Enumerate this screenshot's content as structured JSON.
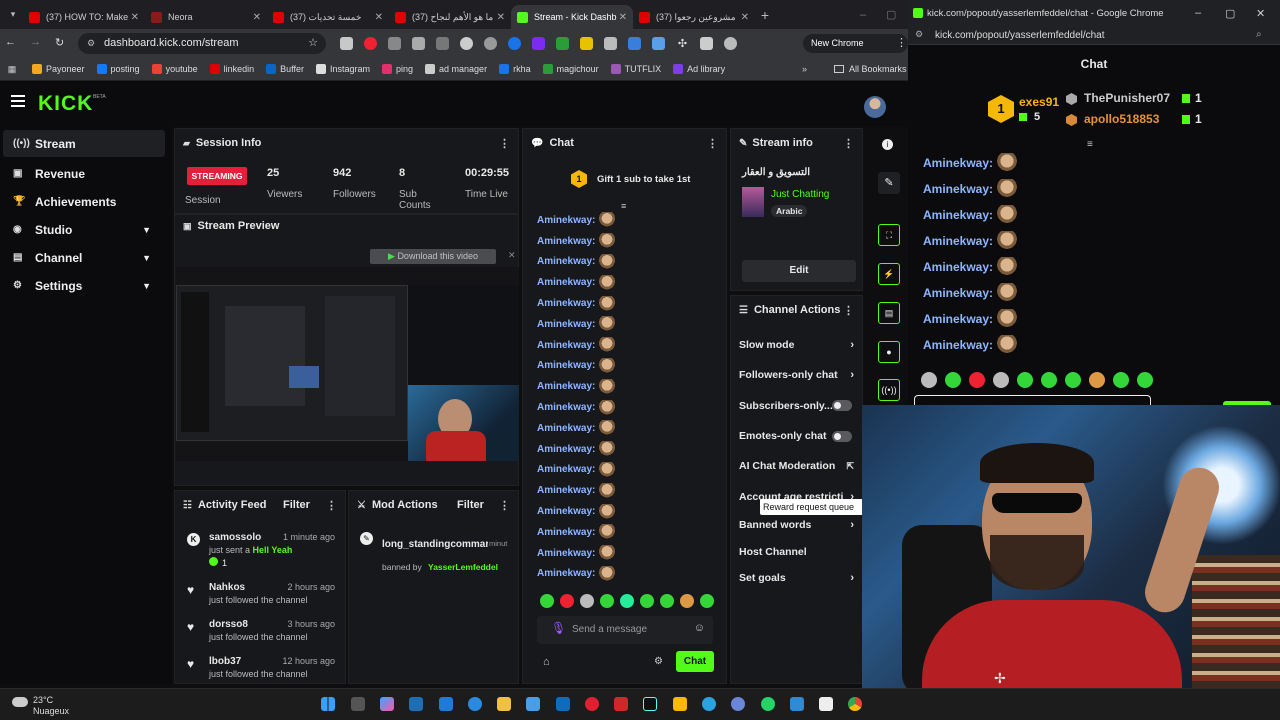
{
  "browser": {
    "tabs": [
      {
        "label": "(37) HOW TO: Make",
        "color": "#e00000"
      },
      {
        "label": "Neora",
        "color": "#8b1a1a"
      },
      {
        "label": "(37) خمسة تحديات",
        "color": "#e00000"
      },
      {
        "label": "(37) ما هو الأهم لنجاح",
        "color": "#e00000"
      },
      {
        "label": "Stream - Kick Dashb",
        "color": "#53fc18"
      },
      {
        "label": "(37) مشروعين رجعوا",
        "color": "#e00000"
      }
    ],
    "url": "dashboard.kick.com/stream",
    "chrome_available": "New Chrome available",
    "bookmarks": [
      "Payoneer",
      "posting",
      "youtube",
      "linkedin",
      "Buffer",
      "Instagram",
      "ping",
      "ad manager",
      "rkha",
      "magichour",
      "TUTFLIX",
      "Ad library"
    ],
    "all_bookmarks": "All Bookmarks"
  },
  "kick": {
    "logo": "KICK",
    "logo_tag": "BETA",
    "accent": "#53fc18",
    "nav": [
      {
        "label": "Stream",
        "icon": "broadcast-icon",
        "active": true,
        "chevron": false
      },
      {
        "label": "Revenue",
        "icon": "revenue-icon",
        "active": false,
        "chevron": false
      },
      {
        "label": "Achievements",
        "icon": "trophy-icon",
        "active": false,
        "chevron": false
      },
      {
        "label": "Studio",
        "icon": "studio-icon",
        "active": false,
        "chevron": true
      },
      {
        "label": "Channel",
        "icon": "channel-icon",
        "active": false,
        "chevron": true
      },
      {
        "label": "Settings",
        "icon": "gear-icon",
        "active": false,
        "chevron": true
      }
    ]
  },
  "session": {
    "title": "Session Info",
    "status": "STREAMING",
    "status_label": "Session",
    "stats": [
      {
        "value": "25",
        "label": "Viewers"
      },
      {
        "value": "942",
        "label": "Followers"
      },
      {
        "value": "8",
        "label": "Sub Counts"
      },
      {
        "value": "00:29:55",
        "label": "Time Live"
      }
    ]
  },
  "preview": {
    "title": "Stream Preview",
    "download": "Download this video"
  },
  "activity": {
    "title": "Activity Feed",
    "filter": "Filter",
    "items": [
      {
        "user": "samossolo",
        "time": "1 minute ago",
        "text": "just sent a",
        "highlight": "Hell Yeah",
        "count": "1",
        "icon": "kick-icon"
      },
      {
        "user": "Nahkos",
        "time": "2 hours ago",
        "text": "just followed the channel",
        "highlight": "",
        "count": "",
        "icon": "heart-icon"
      },
      {
        "user": "dorsso8",
        "time": "3 hours ago",
        "text": "just followed the channel",
        "highlight": "",
        "count": "",
        "icon": "heart-icon"
      },
      {
        "user": "lbob37",
        "time": "12 hours ago",
        "text": "just followed the channel",
        "highlight": "",
        "count": "",
        "icon": "heart-icon"
      }
    ]
  },
  "mod": {
    "title": "Mod Actions",
    "filter": "Filter",
    "user": "long_standingcommar",
    "time": "minut",
    "banned_by": "banned by",
    "moderator": "YasserLemfeddel"
  },
  "chat": {
    "title": "Chat",
    "gift_badge": "1",
    "gift_text": "Gift 1 sub to take 1st",
    "username": "Aminekway",
    "line_count": 18,
    "placeholder": "Send a message",
    "send": "Chat"
  },
  "streaminfo": {
    "title": "Stream info",
    "stream_title": "التسويق و العقار",
    "category": "Just Chatting",
    "tag": "Arabic",
    "edit": "Edit"
  },
  "actions": {
    "title": "Channel Actions",
    "items": [
      {
        "label": "Slow mode",
        "type": "arrow"
      },
      {
        "label": "Followers-only chat",
        "type": "arrow"
      },
      {
        "label": "Subscribers-only...",
        "type": "toggle"
      },
      {
        "label": "Emotes-only chat",
        "type": "toggle"
      },
      {
        "label": "AI Chat Moderation",
        "type": "external"
      },
      {
        "label": "Account age restriction",
        "type": "arrow"
      },
      {
        "label": "Banned words",
        "type": "arrow"
      },
      {
        "label": "Host Channel",
        "type": "none"
      },
      {
        "label": "Set goals",
        "type": "arrow"
      }
    ],
    "tooltip": "Reward request queue"
  },
  "popout": {
    "window_title": "kick.com/popout/yasserlemfeddel/chat - Google Chrome",
    "url": "kick.com/popout/yasserlemfeddel/chat",
    "title": "Chat",
    "leader_rank": "1",
    "leader_name": "exes91",
    "leader_count": "5",
    "gifters": [
      {
        "name": "ThePunisher07",
        "count": "1"
      },
      {
        "name": "apollo518853",
        "count": "1"
      }
    ],
    "username": "Aminekway",
    "line_count": 8
  },
  "taskbar": {
    "temp": "23°C",
    "weather": "Nuageux"
  }
}
